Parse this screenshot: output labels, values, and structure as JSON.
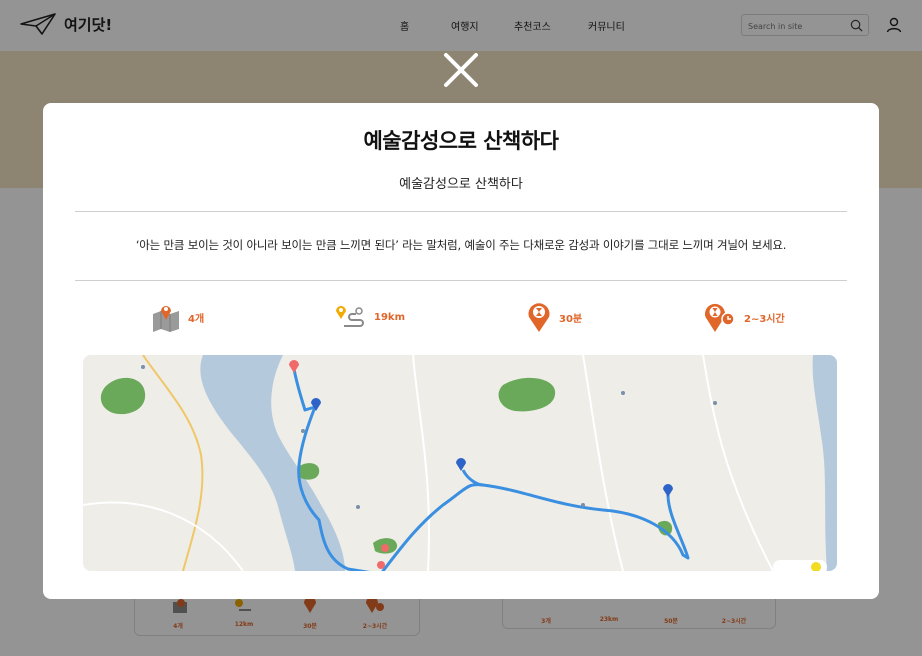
{
  "header": {
    "logo_text": "여기닷!",
    "nav": [
      "홈",
      "여행지",
      "추천코스",
      "커뮤니티"
    ],
    "search_placeholder": "Search in site"
  },
  "background_cards": [
    {
      "stats": [
        "4개",
        "12km",
        "30분",
        "2~3시간"
      ]
    },
    {
      "stats": [
        "3개",
        "23km",
        "50분",
        "2~3시간"
      ]
    }
  ],
  "modal": {
    "title": "예술감성으로 산책하다",
    "subtitle": "예술감성으로 산책하다",
    "description": "‘아는 만큼 보이는 것이 아니라 보이는 만큼 느끼면 된다’ 라는 말처럼, 예술이 주는 다채로운 감성과 이야기를 그대로 느끼며 겨닐어 보세요.",
    "stats": [
      {
        "icon": "map-pin-icon",
        "label": "4개"
      },
      {
        "icon": "route-icon",
        "label": "19km"
      },
      {
        "icon": "clock-pin-icon",
        "label": "30분"
      },
      {
        "icon": "hourglass-pin-icon",
        "label": "2~3시간"
      }
    ]
  },
  "colors": {
    "accent": "#e0662a",
    "banner": "#f3e3c4",
    "river": "#b5c9dc",
    "route": "#3b8fe0",
    "park": "#6aa95a"
  }
}
